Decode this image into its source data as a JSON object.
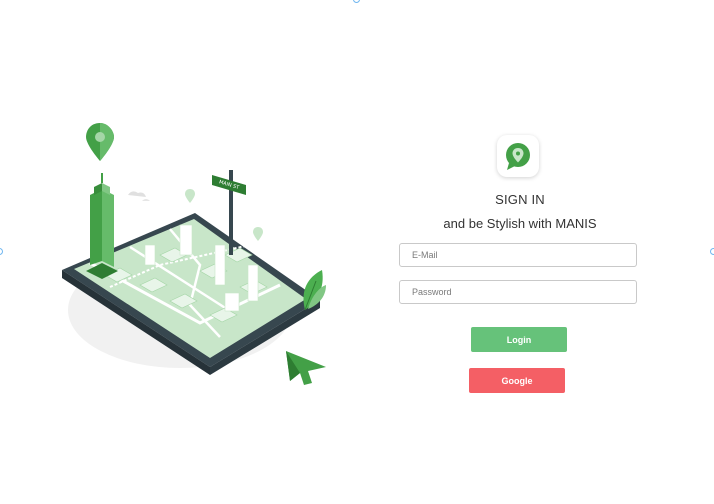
{
  "colors": {
    "accent_green": "#66c27a",
    "google_red": "#f45f65",
    "illustration_dark": "#37474f",
    "map_green": "#a5d6a7"
  },
  "illustration": {
    "icon": "city-map-phone-illustration",
    "sign_text": "MAIN ST"
  },
  "logo": {
    "icon": "map-pin-chat-icon"
  },
  "auth": {
    "title": "SIGN IN",
    "subtitle": "and be Stylish with MANIS",
    "email_placeholder": "E-Mail",
    "password_placeholder": "Password",
    "login_label": "Login",
    "google_label": "Google"
  }
}
